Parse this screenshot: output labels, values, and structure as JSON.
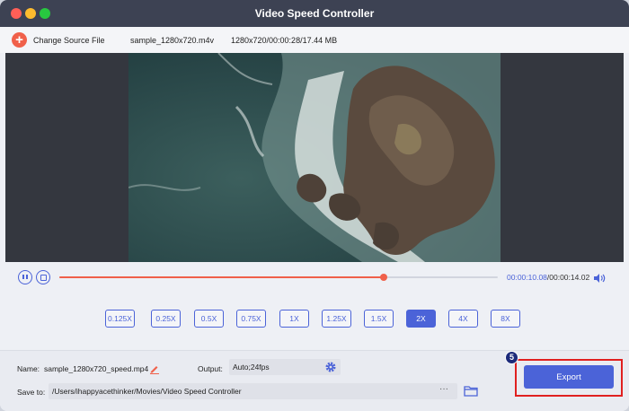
{
  "window": {
    "title": "Video Speed Controller"
  },
  "source": {
    "change_label": "Change Source File",
    "filename": "sample_1280x720.m4v",
    "meta": "1280x720/00:00:28/17.44 MB"
  },
  "player": {
    "current_time": "00:00:10.08",
    "total_time": "/00:00:14.02",
    "progress": 0.74
  },
  "speeds": {
    "options": [
      "0.125X",
      "0.25X",
      "0.5X",
      "0.75X",
      "1X",
      "1.25X",
      "1.5X",
      "2X",
      "4X",
      "8X"
    ],
    "selected": "2X"
  },
  "output": {
    "name_label": "Name:",
    "name_value": "sample_1280x720_speed.mp4",
    "output_label": "Output:",
    "output_value": "Auto;24fps",
    "save_label": "Save to:",
    "save_path": "/Users/ihappyacethinker/Movies/Video Speed Controller",
    "browse_label": "···"
  },
  "export": {
    "label": "Export",
    "step_badge": "5"
  },
  "colors": {
    "accent": "#4b63d8",
    "orange": "#f0604a",
    "titlebar": "#3d4253",
    "highlight": "#e02020"
  }
}
